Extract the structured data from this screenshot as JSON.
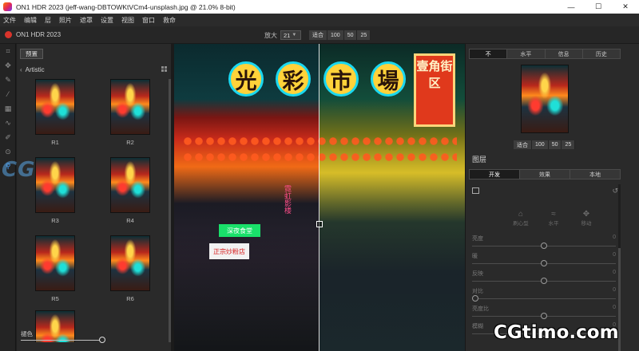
{
  "window": {
    "title": "ON1 HDR 2023 (jeff-wang-DBTOWKtVCm4-unsplash.jpg @ 21.0% 8-bit)",
    "minimize": "—",
    "maximize": "☐",
    "close": "✕"
  },
  "menu": [
    "文件",
    "编辑",
    "层",
    "照片",
    "遮罩",
    "设置",
    "视图",
    "窗口",
    "救命"
  ],
  "app_header": {
    "brand": "ON1 HDR 2023",
    "zoom_label": "放大",
    "zoom_value": "21",
    "fit_buttons": [
      "适合",
      "100",
      "50",
      "25"
    ]
  },
  "browser": {
    "preset_button": "预置",
    "category": "Artistic",
    "presets": [
      "R1",
      "R2",
      "R3",
      "R4",
      "R5",
      "R6"
    ],
    "fade_label": "褪色"
  },
  "canvas": {
    "signs": [
      "光",
      "彩",
      "市",
      "場"
    ],
    "vertical_sign": "壹角街区",
    "stall_sign_1": "深夜食堂",
    "stall_sign_2": "正宗炒粉店",
    "vertical_strip": "霓虹影楼"
  },
  "right_panel": {
    "nav_tabs": [
      "不",
      "水平",
      "信息",
      "历史"
    ],
    "nav_fit_buttons": [
      "适合",
      "100",
      "50",
      "25"
    ],
    "layers_title": "图层",
    "layers_tabs": [
      "开发",
      "效果",
      "本地"
    ],
    "mask_tools": [
      {
        "icon": "bucket-icon",
        "label": "刷心型"
      },
      {
        "icon": "wave-icon",
        "label": "水平"
      },
      {
        "icon": "move-icon",
        "label": "移动"
      }
    ],
    "sliders": [
      {
        "label": "亮度",
        "value": "0",
        "pos": 0.5
      },
      {
        "label": "暖",
        "value": "0",
        "pos": 0.5
      },
      {
        "label": "反映",
        "value": "0",
        "pos": 0.5
      },
      {
        "label": "对比",
        "value": "0",
        "pos": 0.0
      },
      {
        "label": "亮度比",
        "value": "0",
        "pos": 0.5
      },
      {
        "label": "模糊",
        "value": "0",
        "pos": 0.5
      }
    ]
  },
  "watermarks": {
    "left": "CG",
    "right": "CGtimo.com"
  }
}
